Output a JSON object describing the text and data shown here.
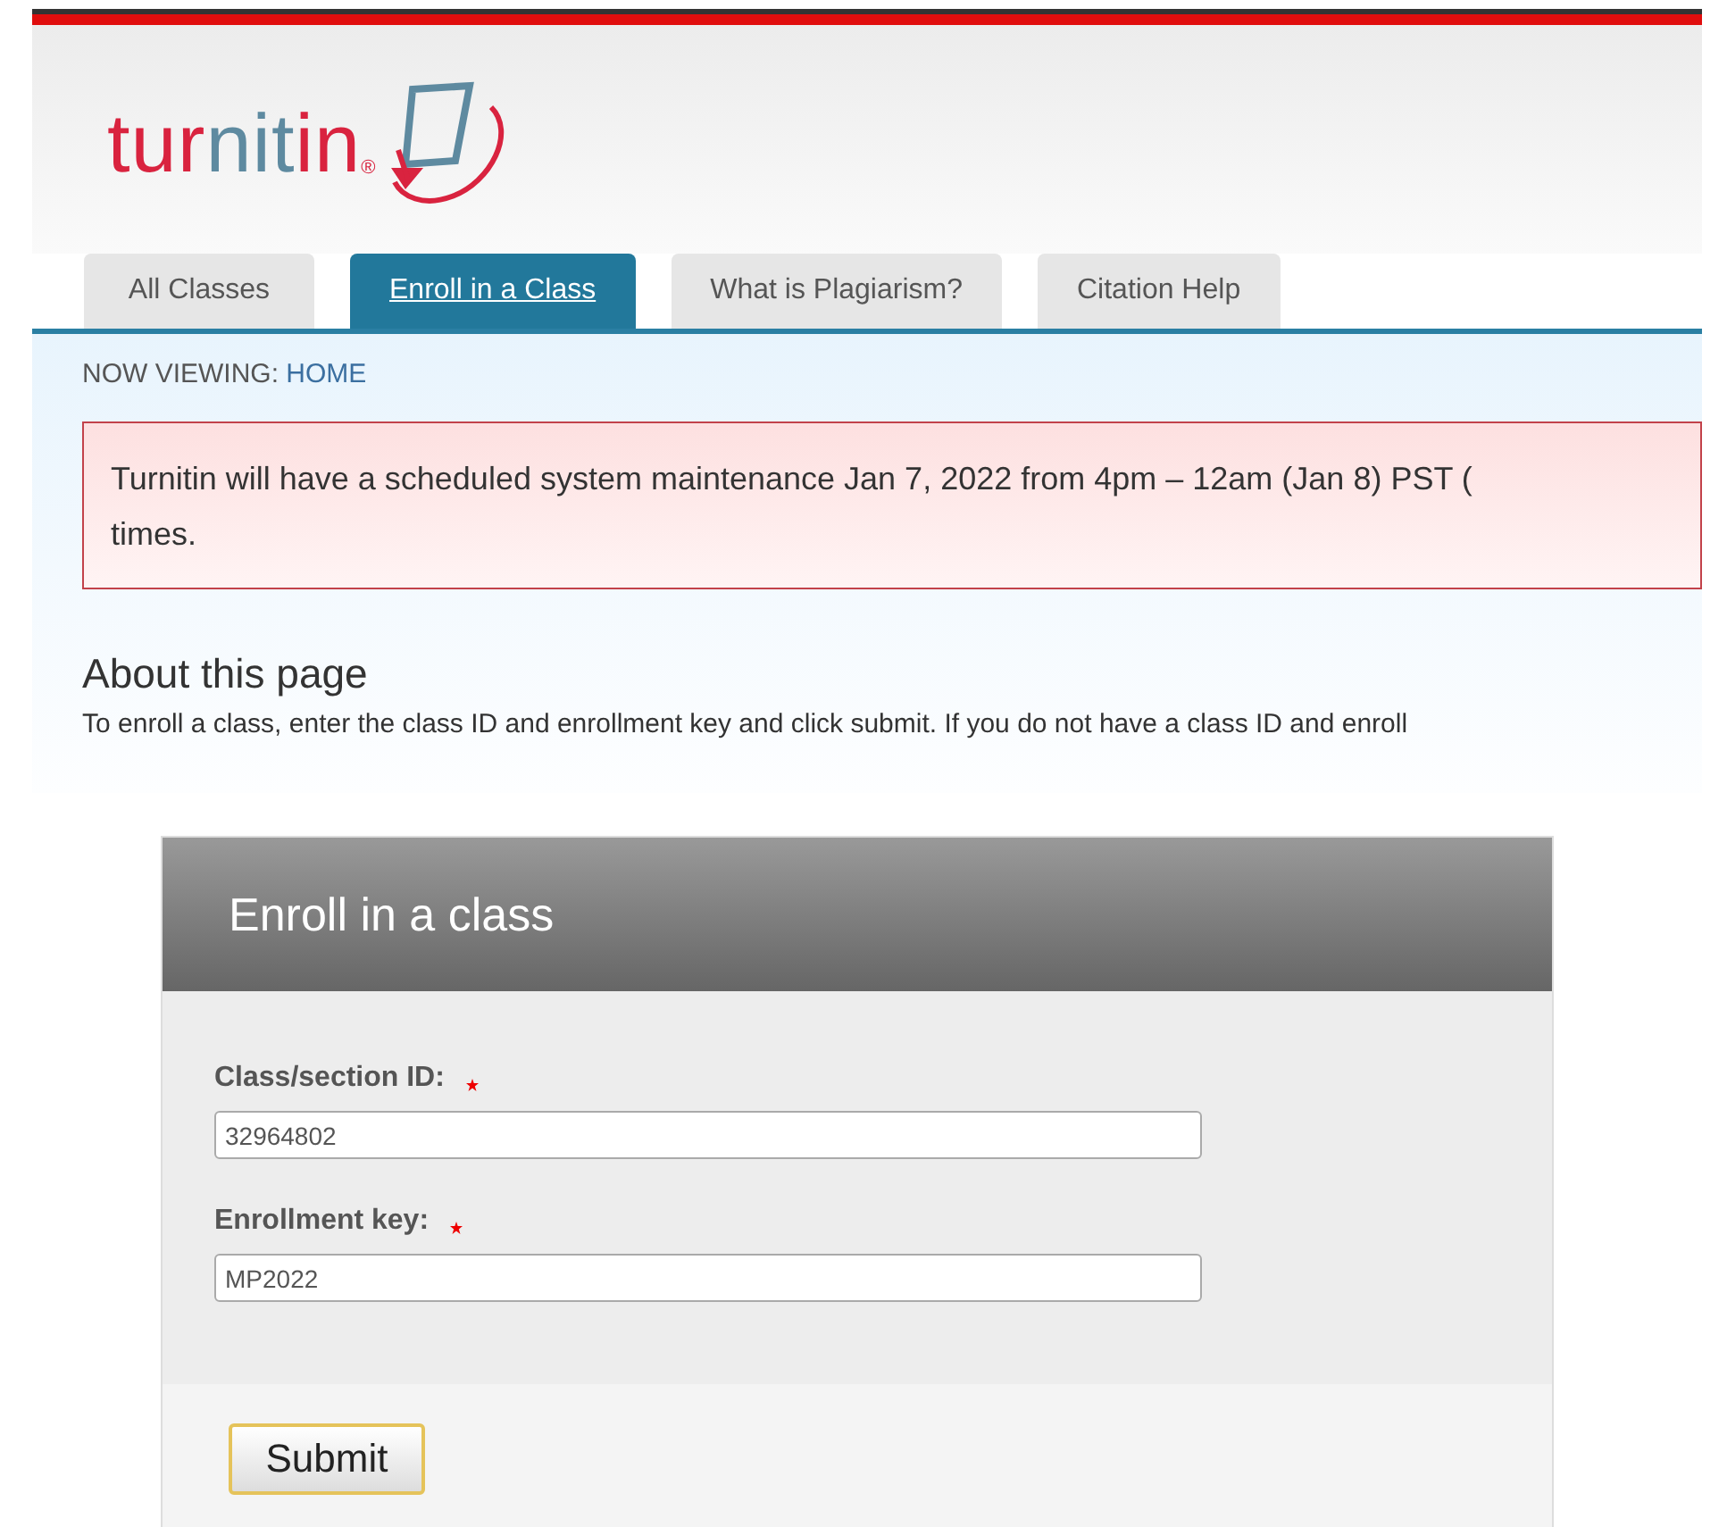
{
  "logo": {
    "parts": [
      {
        "text": "tur",
        "color": "#d9233f"
      },
      {
        "text": "nit",
        "color": "#5e8aa0"
      },
      {
        "text": "in",
        "color": "#d9233f"
      }
    ],
    "mark": "®"
  },
  "tabs": [
    {
      "label": "All Classes",
      "selected": false
    },
    {
      "label": "Enroll in a Class",
      "selected": true
    },
    {
      "label": "What is Plagiarism?",
      "selected": false
    },
    {
      "label": "Citation Help",
      "selected": false
    }
  ],
  "breadcrumb": {
    "label": "NOW VIEWING:",
    "page": "HOME"
  },
  "notice": {
    "lines": [
      "Turnitin will have a scheduled system maintenance Jan 7, 2022 from 4pm – 12am (Jan 8) PST (",
      "times."
    ]
  },
  "about": {
    "title": "About this page",
    "text": "To enroll a class, enter the class ID and enrollment key and click submit. If you do not have a class ID and enroll"
  },
  "form": {
    "title": "Enroll in a class",
    "fields": [
      {
        "label": "Class/section ID:",
        "required": true,
        "value": "32964802"
      },
      {
        "label": "Enrollment key:",
        "required": true,
        "value": "MP2022"
      }
    ],
    "submit": "Submit"
  }
}
